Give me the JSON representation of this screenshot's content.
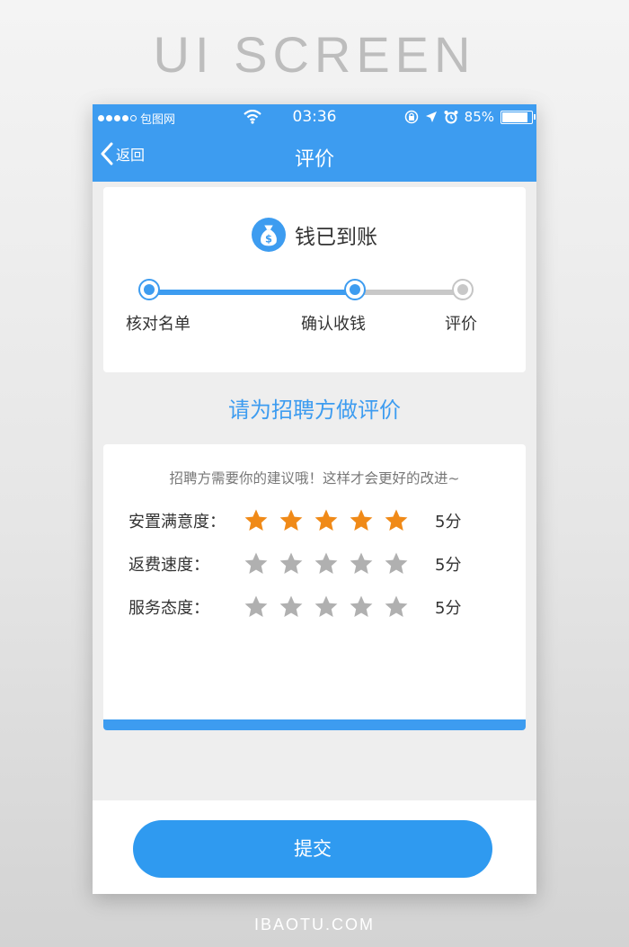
{
  "banner": {
    "title": "UI SCREEN",
    "footer": "IBAOTU.COM"
  },
  "statusbar": {
    "carrier": "包图网",
    "time": "03:36",
    "battery": "85%"
  },
  "navbar": {
    "back_label": "返回",
    "title": "评价"
  },
  "progress": {
    "status_text": "钱已到账",
    "steps": [
      {
        "label": "核对名单",
        "state": "done"
      },
      {
        "label": "确认收钱",
        "state": "current"
      },
      {
        "label": "评价",
        "state": "pending"
      }
    ]
  },
  "prompt": {
    "title": "请为招聘方做评价"
  },
  "rating": {
    "hint": "招聘方需要你的建议哦！这样才会更好的改进~",
    "rows": [
      {
        "label": "安置满意度：",
        "score_text": "5分",
        "filled": 5,
        "max": 5
      },
      {
        "label": "返费速度：",
        "score_text": "5分",
        "filled": 0,
        "max": 5
      },
      {
        "label": "服务态度：",
        "score_text": "5分",
        "filled": 0,
        "max": 5
      }
    ]
  },
  "actions": {
    "submit_label": "提交"
  },
  "colors": {
    "primary": "#3d9cf0",
    "star_filled": "#f08a18",
    "star_empty": "#b0b0b0"
  },
  "icons": [
    "back-chevron-icon",
    "wifi-icon",
    "money-bag-icon",
    "star-icon",
    "alarm-icon",
    "location-arrow-icon",
    "lock-rotation-icon"
  ]
}
